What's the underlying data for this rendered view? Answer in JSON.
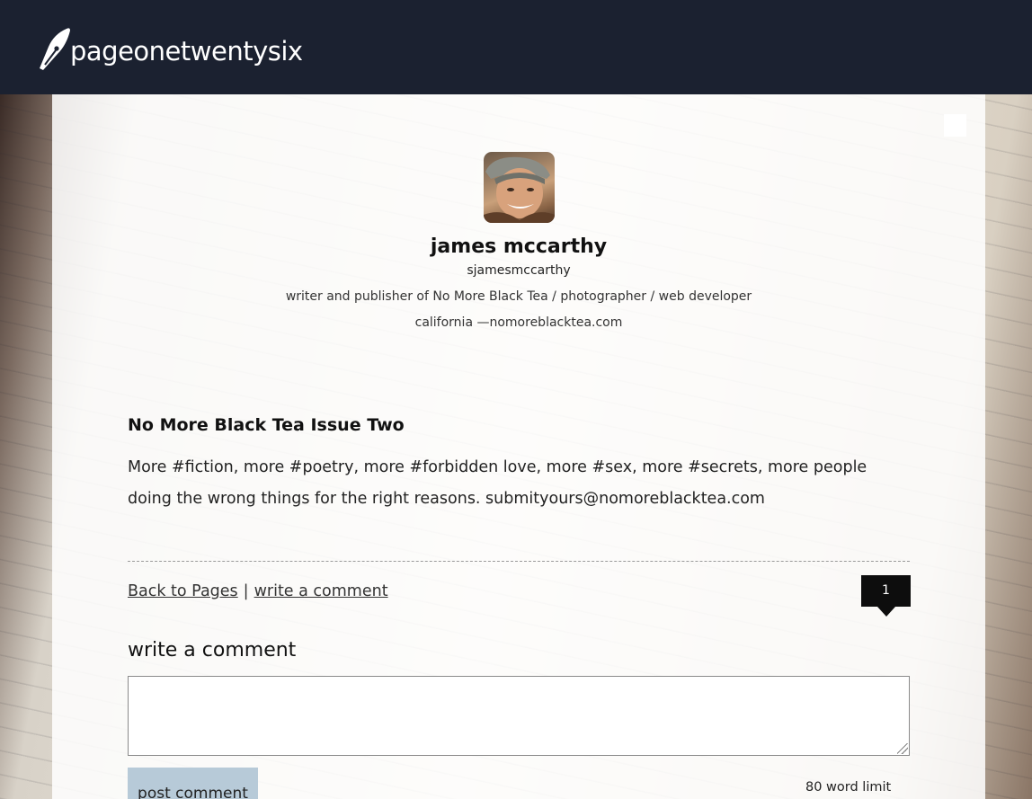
{
  "header": {
    "logo_text": "pageonetwentysix",
    "icon": "pen-nib-icon"
  },
  "profile": {
    "name": "james mccarthy",
    "handle": "sjamesmccarthy",
    "bio": "writer and publisher of No More Black Tea / photographer / web developer",
    "location": "california —nomoreblacktea.com"
  },
  "post": {
    "title": "No More Black Tea Issue Two",
    "body": "More #fiction, more #poetry, more #forbidden love, more #sex, more #secrets, more people doing the wrong things for the right reasons. submityours@nomoreblacktea.com"
  },
  "actions": {
    "back_label": "Back to Pages",
    "separator": "|",
    "write_comment_link": "write a comment",
    "comment_count": "1"
  },
  "comment_form": {
    "heading": "write a comment",
    "value": "",
    "submit_label": "post comment",
    "word_limit": "80 word limit"
  }
}
